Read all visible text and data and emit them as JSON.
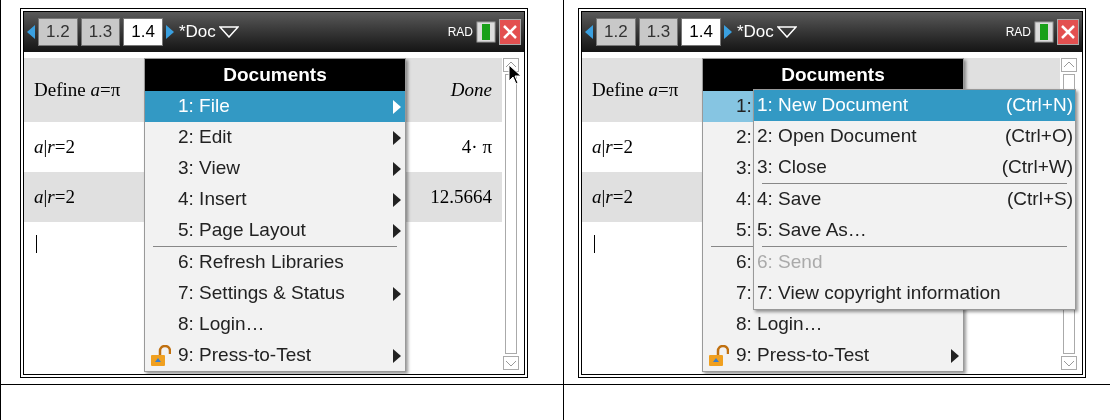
{
  "panels": [
    {
      "tabs": [
        {
          "label": "1.2",
          "selected": false
        },
        {
          "label": "1.3",
          "selected": false
        },
        {
          "label": "1.4",
          "selected": true
        }
      ],
      "document": "*Doc",
      "angle_mode": "RAD",
      "pointer_visible": true,
      "history": [
        {
          "input": "Define *a*=π",
          "result": "Done",
          "kind": "message"
        },
        {
          "input": "*a*|*r*=2",
          "result": "4· π",
          "kind": "value"
        },
        {
          "input": "*a*|*r*=2",
          "result": "12.5664",
          "kind": "value"
        }
      ],
      "menu": {
        "title": "Documents",
        "active": true,
        "items": [
          {
            "kind": "item",
            "label": "1: File",
            "submenu": true,
            "selected": true
          },
          {
            "kind": "item",
            "label": "2: Edit",
            "submenu": true,
            "selected": false
          },
          {
            "kind": "item",
            "label": "3: View",
            "submenu": true,
            "selected": false
          },
          {
            "kind": "item",
            "label": "4: Insert",
            "submenu": true,
            "selected": false
          },
          {
            "kind": "item",
            "label": "5: Page Layout",
            "submenu": true,
            "selected": false
          },
          {
            "kind": "separator"
          },
          {
            "kind": "item",
            "label": "6: Refresh Libraries",
            "submenu": false,
            "selected": false
          },
          {
            "kind": "item",
            "label": "7: Settings & Status",
            "submenu": true,
            "selected": false
          },
          {
            "kind": "item",
            "label": "8: Login…",
            "submenu": false,
            "selected": false
          },
          {
            "kind": "item",
            "label": "9: Press-to-Test",
            "submenu": true,
            "selected": false,
            "locked": false
          }
        ]
      }
    },
    {
      "tabs": [
        {
          "label": "1.2",
          "selected": false
        },
        {
          "label": "1.3",
          "selected": false
        },
        {
          "label": "1.4",
          "selected": true
        }
      ],
      "document": "*Doc",
      "angle_mode": "RAD",
      "pointer_visible": false,
      "history": [
        {
          "input": "Define *a*=π"
        },
        {
          "input": "*a*|*r*=2"
        },
        {
          "input": "*a*|*r*=2"
        }
      ],
      "menu": {
        "title": "Documents",
        "active": false,
        "items": [
          {
            "kind": "item",
            "label": "1:",
            "selected": true
          },
          {
            "kind": "item",
            "label": "2:",
            "selected": false
          },
          {
            "kind": "item",
            "label": "3:",
            "selected": false
          },
          {
            "kind": "item",
            "label": "4:",
            "selected": false
          },
          {
            "kind": "item",
            "label": "5:",
            "selected": false
          },
          {
            "kind": "separator"
          },
          {
            "kind": "item",
            "label": "6:",
            "selected": false
          },
          {
            "kind": "item",
            "label": "7:",
            "selected": false
          },
          {
            "kind": "item",
            "label": "8: Login…",
            "submenu": false,
            "selected": false
          },
          {
            "kind": "item",
            "label": "9: Press-to-Test",
            "submenu": true,
            "selected": false,
            "locked": false
          }
        ]
      },
      "submenu": {
        "items": [
          {
            "kind": "item",
            "label": "1: New Document",
            "shortcut": "(Ctrl+N)",
            "selected": true,
            "disabled": false
          },
          {
            "kind": "item",
            "label": "2: Open Document",
            "shortcut": "(Ctrl+O)",
            "selected": false,
            "disabled": false
          },
          {
            "kind": "item",
            "label": "3: Close",
            "shortcut": "(Ctrl+W)",
            "selected": false,
            "disabled": false
          },
          {
            "kind": "separator"
          },
          {
            "kind": "item",
            "label": "4: Save",
            "shortcut": "(Ctrl+S)",
            "selected": false,
            "disabled": false
          },
          {
            "kind": "item",
            "label": "5: Save As…",
            "selected": false,
            "disabled": false
          },
          {
            "kind": "separator"
          },
          {
            "kind": "item",
            "label": "6: Send",
            "selected": false,
            "disabled": true
          },
          {
            "kind": "item",
            "label": "7: View copyright information",
            "selected": false,
            "disabled": false
          }
        ]
      }
    }
  ]
}
